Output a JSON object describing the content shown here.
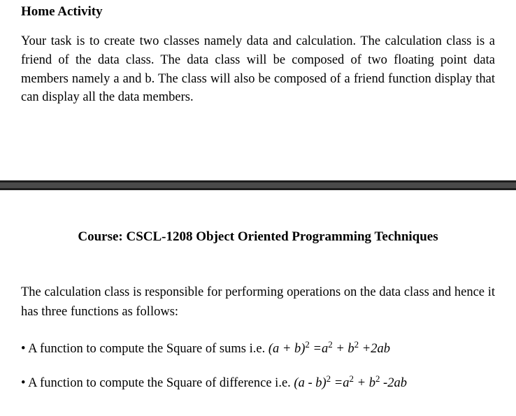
{
  "top": {
    "heading": "Home Activity",
    "paragraph": "Your task is to create two classes namely data and calculation. The calculation class is a friend of the data class. The data class will be composed of two floating point data members namely a and b. The class will also be composed of a friend function display that can display all the data members."
  },
  "course": {
    "label": "Course: CSCL-1208 Object Oriented Programming Techniques"
  },
  "bottom": {
    "intro": "The calculation class is responsible for performing operations on the data class and hence it has three functions as follows:",
    "bullets": [
      {
        "prefix": "• A function to compute the Square of sums i.e. ",
        "formula_html": "(<i>a</i> + <i>b</i>)<span class='sup'>2</span> =<i>a</i><span class='sup'>2</span> + <i>b</i><span class='sup'>2</span> +2<i>ab</i>"
      },
      {
        "prefix": "• A function to compute the Square of difference i.e. ",
        "formula_html": "(<i>a</i> - <i>b</i>)<span class='sup'>2</span> =<i>a</i><span class='sup'>2</span> + <i>b</i><span class='sup'>2</span> -2<i>ab</i>"
      }
    ]
  }
}
